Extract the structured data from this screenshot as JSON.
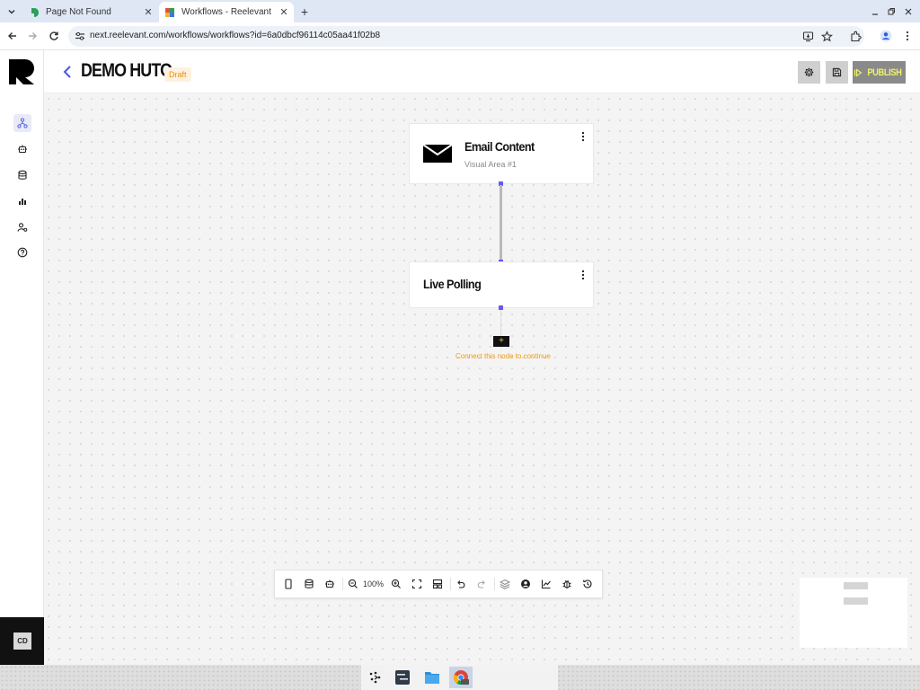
{
  "browser": {
    "tabs": [
      {
        "title": "Page Not Found",
        "active": false,
        "favicon": "reelevant-favicon-green"
      },
      {
        "title": "Workflows - Reelevant",
        "active": true,
        "favicon": "reelevant-favicon-color"
      }
    ],
    "url": "next.reelevant.com/workflows/workflows?id=6a0dbcf96114c05aa41f02b8"
  },
  "sidebar": {
    "items": [
      {
        "icon": "workflow-icon",
        "active": true
      },
      {
        "icon": "robot-icon",
        "active": false
      },
      {
        "icon": "database-icon",
        "active": false
      },
      {
        "icon": "bar-chart-icon",
        "active": false
      },
      {
        "icon": "user-settings-icon",
        "active": false
      },
      {
        "icon": "help-icon",
        "active": false
      }
    ],
    "user_initials": "CD"
  },
  "header": {
    "title": "DEMO HUTO",
    "status_badge": "Draft",
    "publish_label": "PUBLISH"
  },
  "canvas": {
    "nodes": [
      {
        "title": "Email Content",
        "subtitle": "Visual Area #1",
        "icon": "envelope-icon"
      },
      {
        "title": "Live Polling",
        "subtitle": ""
      }
    ],
    "add_node_label": "+",
    "connect_hint": "Connect this node to continue"
  },
  "toolbar": {
    "zoom": "100%"
  },
  "colors": {
    "accent": "#6459f0",
    "draft_text": "#f08c00",
    "publish_text": "#ecf36a",
    "hint": "#f29a0e"
  }
}
